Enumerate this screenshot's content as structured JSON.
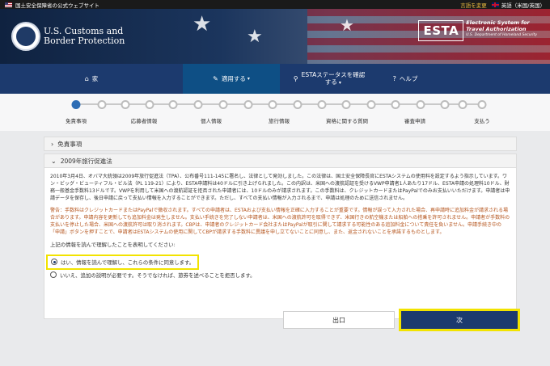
{
  "topbar": {
    "official_site": "国土安全保障省の公式ウェブサイト",
    "change_language": "言語を変更",
    "current_language": "英語（米国/英国）"
  },
  "header": {
    "agency_line1": "U.S. Customs and",
    "agency_line2": "Border Protection",
    "esta_mark": "ESTA",
    "esta_line1": "Electronic System for",
    "esta_line2": "Travel Authorization",
    "esta_line3": "U.S. Department of Homeland Security"
  },
  "nav": {
    "home": "家",
    "apply": "適用する",
    "status_line1": "ESTAステータスを確認",
    "status_line2": "する",
    "help": "ヘルプ"
  },
  "progress": {
    "steps": [
      "免責事項",
      "応募者情報",
      "個人情報",
      "旅行情報",
      "資格に関する質問",
      "審査申請",
      "支払う"
    ],
    "current_index": 0
  },
  "accordion": {
    "disclaimer": "免責事項",
    "travel_promotion_act": "2009年旅行促進法"
  },
  "panel": {
    "paragraph": "2010年3月4日、オバマ大統領は2009年旅行促進法（TPA）、公布番号111-145に署名し、法律として発効しました。この法律は、国土安全保障長官にESTAシステムの使用料を設定するよう指示しています。ワン・ビッグ・ビューティフル・ビル法（PL 119-21）により、ESTA申請料は40ドルに引き上げられました。この内訳は、米国への渡航認証を受けるVWP申請者1人あたり17ドル、ESTA申請の処理料10ドル、財務一般基金手数料13ドルです。VWPを利用して米国への渡航認証を拒否された申請者には、10ドルのみが請求されます。この手数料は、クレジットカードまたはPayPalでのみお支払いいただけます。申請者は申請データを保存し、後日申請に戻って支払い情報を入力することができます。ただし、すべての支払い情報が入力されるまで、申請は処理のために送信されません。",
    "warning": "警告：手数料はクレジットカードまたはPayPalで徴収されます。すべての申請者は、ESTAおよび支払い情報を正確に入力することが重要です。情報が誤って入力された場合、再申請時に追加料金が請求される場合があります。申請内容を更新しても追加料金は発生しません。支払い手続きを完了しない申請者は、米国への渡航許可を取得できず、米国行きの航空機または船舶への搭乗を許可されません。申請者が手数料の支払いを停止した場合、米国への渡航許可は取り消されます。CBPは、申請者のクレジットカード会社またはPayPalが取引に関して請求する可能性のある追加料金について責任を負いません。申請手続き中の「申請」ボタンを押すことで、申請者はESTAシステムの使用に関してCBPが請求する手数料に異議を申し立てないことに同意し、また、返金されないことを承諾するものとします。",
    "confirm_prompt": "上記の情報を読んで理解したことを表明してください:",
    "option_yes": "はい、情報を読んで理解し、これらの条件に同意します。",
    "option_no": "いいえ、追加の説明が必要です。そうでなければ、旅券を述べることを拒否します。",
    "selected": "yes"
  },
  "buttons": {
    "exit": "出口",
    "next": "次"
  }
}
